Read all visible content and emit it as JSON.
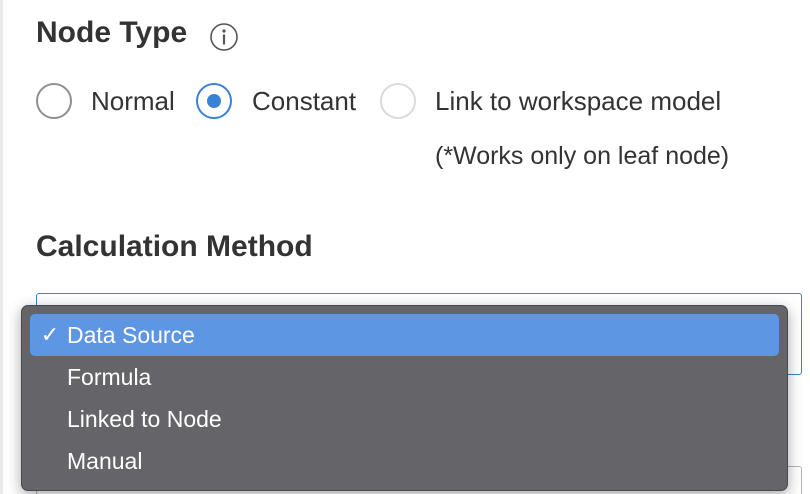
{
  "node_type": {
    "title": "Node Type",
    "info_icon": "info-icon",
    "options": [
      {
        "label": "Normal",
        "state": "unselected"
      },
      {
        "label": "Constant",
        "state": "selected"
      },
      {
        "label": "Link to workspace model",
        "state": "disabled"
      }
    ],
    "note": "(*Works only on leaf node)"
  },
  "calculation_method": {
    "title": "Calculation Method",
    "dropdown": {
      "selected_check": "✓",
      "options": [
        {
          "label": "Data Source",
          "selected": true
        },
        {
          "label": "Formula",
          "selected": false
        },
        {
          "label": "Linked to Node",
          "selected": false
        },
        {
          "label": "Manual",
          "selected": false
        }
      ]
    }
  },
  "colors": {
    "accent": "#3a82d6",
    "menu_background": "#656468",
    "menu_highlight": "#5d97e3",
    "text": "#333333"
  }
}
